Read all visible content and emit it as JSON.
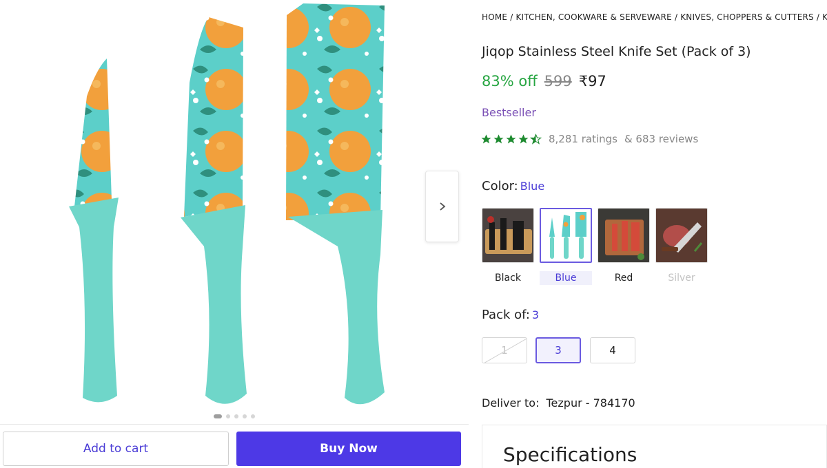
{
  "product": {
    "breadcrumb": "HOME / KITCHEN, COOKWARE & SERVEWARE / KNIVES, CHOPPERS & CUTTERS / KITCH",
    "title": "Jiqop Stainless Steel Knife Set (Pack of 3)",
    "discount": "83% off",
    "mrp": "599",
    "price": "₹97",
    "badge": "Bestseller",
    "rating_value": 4.5,
    "ratings_text": "8,281 ratings",
    "reviews_text": "& 683 reviews"
  },
  "gallery": {
    "slide_count": 5,
    "active_slide": 1,
    "next_icon": "chevron-right-icon"
  },
  "color": {
    "label": "Color:",
    "selected": "Blue",
    "options": [
      {
        "label": "Black",
        "state": "available"
      },
      {
        "label": "Blue",
        "state": "selected"
      },
      {
        "label": "Red",
        "state": "available"
      },
      {
        "label": "Silver",
        "state": "unavailable"
      }
    ]
  },
  "pack": {
    "label": "Pack of:",
    "selected": "3",
    "options": [
      {
        "label": "1",
        "state": "unavailable"
      },
      {
        "label": "3",
        "state": "selected"
      },
      {
        "label": "4",
        "state": "available"
      }
    ]
  },
  "delivery": {
    "label": "Deliver to:",
    "location": "Tezpur - 784170"
  },
  "actions": {
    "add_to_cart": "Add to cart",
    "buy_now": "Buy Now"
  },
  "specifications": {
    "heading": "Specifications"
  },
  "colors": {
    "accent": "#4d39e6",
    "discount_green": "#26a541",
    "rating_star": "#1d8a2f",
    "badge_purple": "#7a4fb5",
    "knife_teal": "#6fd6c9",
    "blade_bg": "#5ccfc9",
    "fruit_orange": "#f2a03c"
  }
}
